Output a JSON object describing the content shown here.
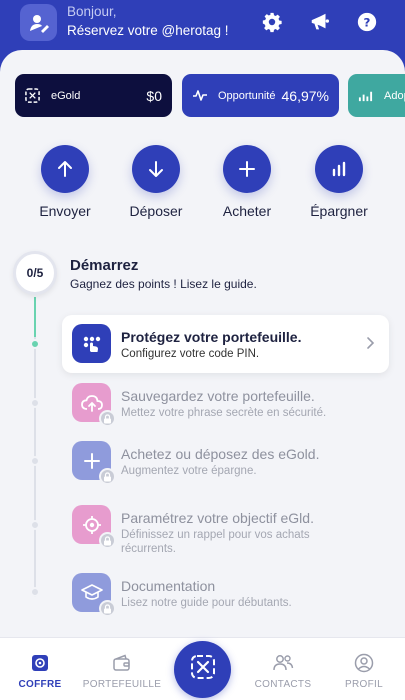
{
  "header": {
    "greeting": "Bonjour,",
    "herotag_prompt": "Réservez votre @herotag !",
    "icons": [
      "user-edit-icon",
      "gear-icon",
      "megaphone-icon",
      "help-icon"
    ]
  },
  "cards": [
    {
      "label": "eGold",
      "value": "$0",
      "icon": "egold-icon",
      "color": "#0d0f3e"
    },
    {
      "label": "Opportunité",
      "value": "46,97%",
      "icon": "pulse-icon",
      "color": "#2f3fb8"
    },
    {
      "label": "Adop",
      "icon": "chart-up-icon",
      "color": "#3fa8a0"
    }
  ],
  "actions": [
    {
      "label": "Envoyer",
      "icon": "arrow-up-icon"
    },
    {
      "label": "Déposer",
      "icon": "arrow-down-icon"
    },
    {
      "label": "Acheter",
      "icon": "plus-icon"
    },
    {
      "label": "Épargner",
      "icon": "bar-chart-icon"
    }
  ],
  "onboarding": {
    "progress_text": "0/5",
    "progress_fraction": 0,
    "title": "Démarrez",
    "subtitle": "Gagnez des points ! Lisez le guide.",
    "steps": [
      {
        "title": "Protégez votre portefeuille.",
        "subtitle": "Configurez votre code PIN.",
        "locked": false,
        "color": "#2f3fb8",
        "icon": "pin-icon"
      },
      {
        "title": "Sauvegardez votre portefeuille.",
        "subtitle": "Mettez votre phrase secrète en sécurité.",
        "locked": true,
        "color": "#e79cce",
        "icon": "cloud-upload-icon"
      },
      {
        "title": "Achetez ou déposez des eGold.",
        "subtitle": "Augmentez votre épargne.",
        "locked": true,
        "color": "#8f9bdc",
        "icon": "plus-icon"
      },
      {
        "title": "Paramétrez votre objectif eGld.",
        "subtitle": "Définissez un rappel pour vos achats récurrents.",
        "locked": true,
        "color": "#e79cce",
        "icon": "target-icon"
      },
      {
        "title": "Documentation",
        "subtitle": "Lisez notre guide pour débutants.",
        "locked": true,
        "color": "#8f9bdc",
        "icon": "graduation-cap-icon"
      }
    ]
  },
  "tabs": [
    {
      "label": "COFFRE",
      "icon": "vault-icon",
      "active": true
    },
    {
      "label": "PORTEFEUILLE",
      "icon": "wallet-icon",
      "active": false
    },
    {
      "label": "CONTACTS",
      "icon": "contacts-icon",
      "active": false
    },
    {
      "label": "PROFIL",
      "icon": "profile-icon",
      "active": false
    }
  ],
  "colors": {
    "primary": "#2f3fb8",
    "accent_green": "#69d3b0",
    "background": "#f3f4f8"
  }
}
